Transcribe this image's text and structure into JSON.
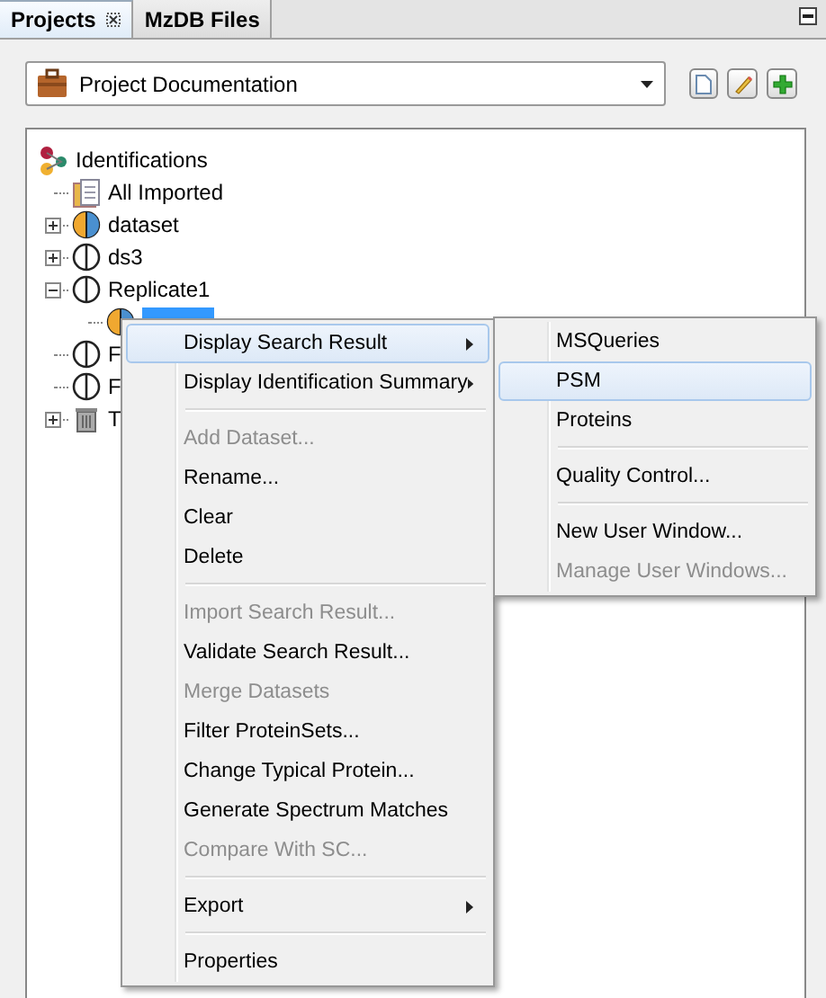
{
  "tabs": [
    {
      "label": "Projects",
      "selected": true,
      "closable": true
    },
    {
      "label": "MzDB Files",
      "selected": false,
      "closable": false
    }
  ],
  "project_selector": {
    "value": "Project Documentation"
  },
  "tree": {
    "label": "Identifications",
    "children": [
      {
        "label": "All Imported",
        "kind": "folder"
      },
      {
        "label": "dataset",
        "kind": "merged",
        "expanded": false
      },
      {
        "label": "ds3",
        "kind": "dataset",
        "expanded": false
      },
      {
        "label": "Replicate1",
        "kind": "dataset",
        "expanded": true,
        "children": [
          {
            "kind": "merged",
            "selected": true
          }
        ]
      },
      {
        "label": "F",
        "kind": "dataset"
      },
      {
        "label": "F",
        "kind": "dataset"
      },
      {
        "label": "T",
        "kind": "trash",
        "expanded": false
      }
    ]
  },
  "context_menu": [
    {
      "kind": "submenu",
      "label": "Display Search Result",
      "selected": true,
      "disabled": false
    },
    {
      "kind": "submenu",
      "label": "Display Identification Summary",
      "selected": false,
      "disabled": false
    },
    {
      "kind": "separator"
    },
    {
      "kind": "item",
      "label": "Add Dataset...",
      "selected": false,
      "disabled": true
    },
    {
      "kind": "item",
      "label": "Rename...",
      "selected": false,
      "disabled": false
    },
    {
      "kind": "item",
      "label": "Clear",
      "selected": false,
      "disabled": false
    },
    {
      "kind": "item",
      "label": "Delete",
      "selected": false,
      "disabled": false
    },
    {
      "kind": "separator"
    },
    {
      "kind": "item",
      "label": "Import Search Result...",
      "selected": false,
      "disabled": true
    },
    {
      "kind": "item",
      "label": "Validate Search Result...",
      "selected": false,
      "disabled": false
    },
    {
      "kind": "item",
      "label": "Merge Datasets",
      "selected": false,
      "disabled": true
    },
    {
      "kind": "item",
      "label": "Filter ProteinSets...",
      "selected": false,
      "disabled": false
    },
    {
      "kind": "item",
      "label": "Change Typical Protein...",
      "selected": false,
      "disabled": false
    },
    {
      "kind": "item",
      "label": "Generate Spectrum Matches",
      "selected": false,
      "disabled": false
    },
    {
      "kind": "item",
      "label": "Compare With SC...",
      "selected": false,
      "disabled": true
    },
    {
      "kind": "separator"
    },
    {
      "kind": "submenu",
      "label": "Export",
      "selected": false,
      "disabled": false
    },
    {
      "kind": "separator"
    },
    {
      "kind": "item",
      "label": "Properties",
      "selected": false,
      "disabled": false
    }
  ],
  "submenu": [
    {
      "kind": "item",
      "label": "MSQueries",
      "selected": false,
      "disabled": false
    },
    {
      "kind": "item",
      "label": "PSM",
      "selected": true,
      "disabled": false
    },
    {
      "kind": "item",
      "label": "Proteins",
      "selected": false,
      "disabled": false
    },
    {
      "kind": "separator"
    },
    {
      "kind": "item",
      "label": "Quality Control...",
      "selected": false,
      "disabled": false
    },
    {
      "kind": "separator"
    },
    {
      "kind": "item",
      "label": "New User Window...",
      "selected": false,
      "disabled": false
    },
    {
      "kind": "item",
      "label": "Manage User Windows...",
      "selected": false,
      "disabled": true
    }
  ]
}
